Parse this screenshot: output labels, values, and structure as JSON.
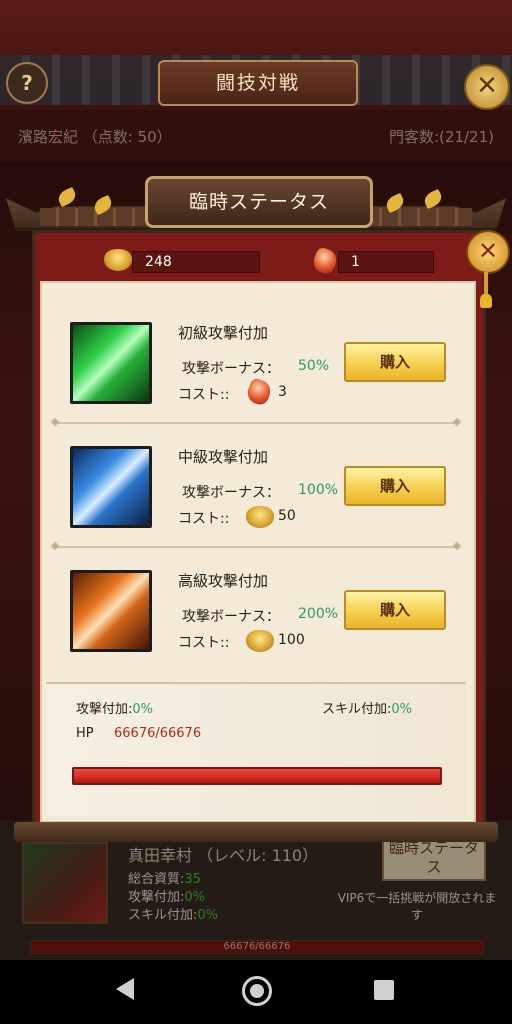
{
  "background": {
    "title": "闘技対戦",
    "help_icon": "?",
    "close_icon": "✕",
    "player_info": "濱路宏紀 （点数: 50）",
    "guest_count": "門客数:(21/21)",
    "hero": {
      "name": "真田幸村 （レベル: 110）",
      "total_quality_label": "総合資質:",
      "total_quality_value": "35",
      "attack_bonus_label": "攻撃付加:",
      "attack_bonus_value": "0%",
      "skill_bonus_label": "スキル付加:",
      "skill_bonus_value": "0%"
    },
    "temp_status_button": "臨時ステータス",
    "vip_note": "VIP6で一括挑戦が開放されます",
    "hp_text": "66676/66676"
  },
  "dialog": {
    "title": "臨時ステータス",
    "close_icon": "✕",
    "resources": {
      "gold": "248",
      "gem": "1"
    },
    "items": [
      {
        "name": "初級攻撃付加",
        "bonus_label": "攻撃ボーナス：",
        "bonus_value": "50%",
        "cost_label": "コスト::",
        "cost_currency": "gem-icon",
        "cost_value": "3",
        "buy_label": "購入",
        "icon": "green-claw-icon"
      },
      {
        "name": "中級攻撃付加",
        "bonus_label": "攻撃ボーナス：",
        "bonus_value": "100%",
        "cost_label": "コスト::",
        "cost_currency": "gold-icon",
        "cost_value": "50",
        "buy_label": "購入",
        "icon": "blue-claw-icon"
      },
      {
        "name": "高級攻撃付加",
        "bonus_label": "攻撃ボーナス：",
        "bonus_value": "200%",
        "cost_label": "コスト::",
        "cost_currency": "gold-icon",
        "cost_value": "100",
        "buy_label": "購入",
        "icon": "orange-claw-icon"
      }
    ],
    "stats": {
      "attack_label": "攻撃付加:",
      "attack_value": "0%",
      "skill_label": "スキル付加:",
      "skill_value": "0%",
      "hp_label": "HP",
      "hp_value": "66676/66676",
      "hp_fraction": 1.0
    }
  },
  "colors": {
    "accent_green": "#2f9a6a",
    "hp_red": "#b22a22",
    "button_gold": "#f5cf4e"
  }
}
